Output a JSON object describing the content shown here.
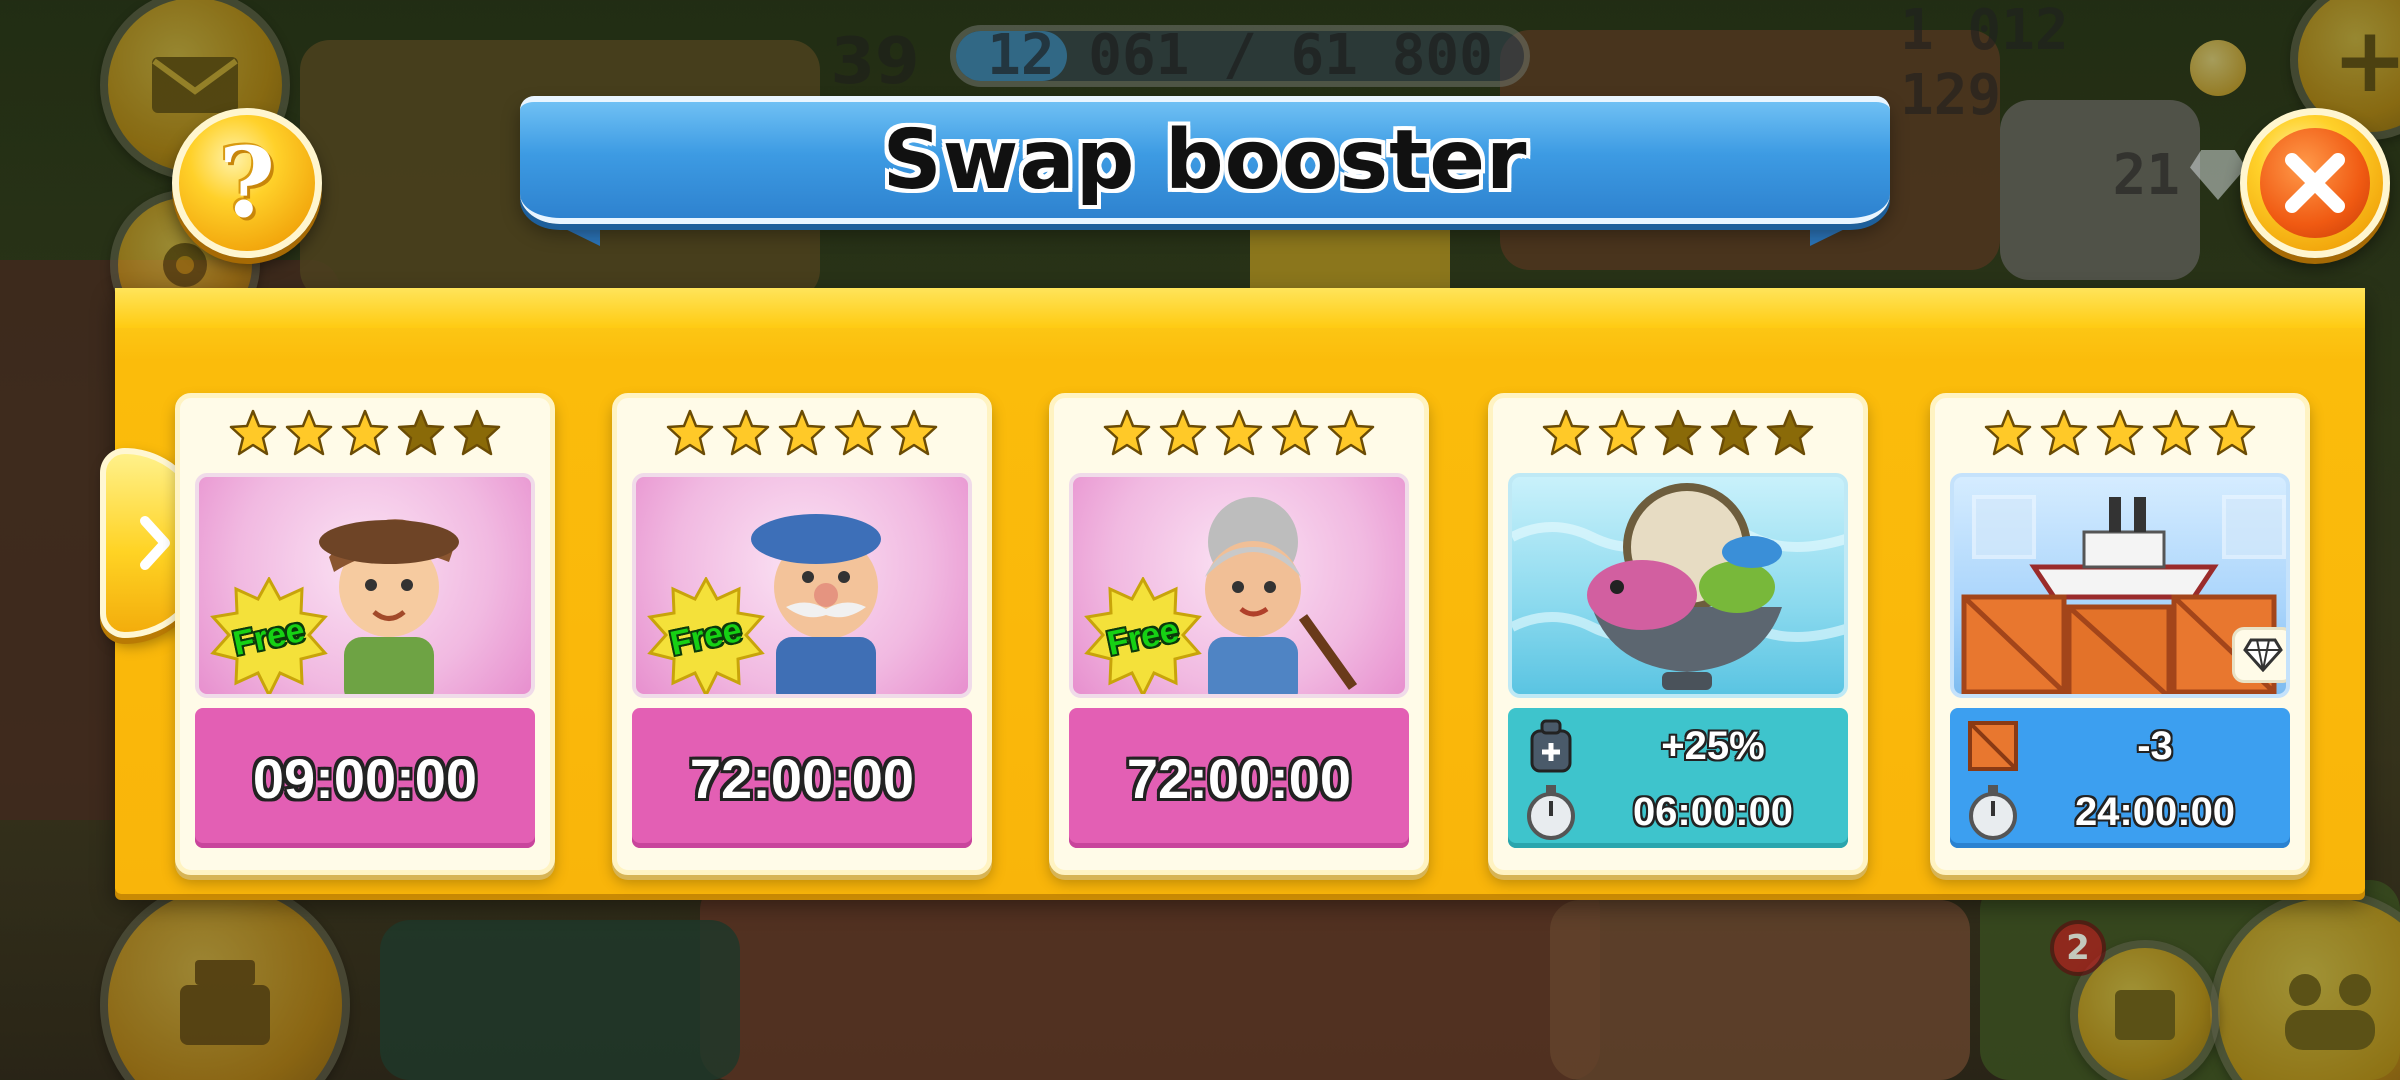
{
  "hud": {
    "level": "39",
    "xp_text": "12 061 / 61 800",
    "xp_progress": 0.195,
    "coins": "1 012 129",
    "gems": "21",
    "notification_count": "2"
  },
  "dialog": {
    "title": "Swap booster",
    "help_glyph": "?",
    "cards": [
      {
        "kind": "helper",
        "stars": 3,
        "free_label": "Free",
        "timer": "09:00:00",
        "icon": "boy-helper-icon"
      },
      {
        "kind": "helper",
        "stars": 5,
        "free_label": "Free",
        "timer": "72:00:00",
        "icon": "grandpa-helper-icon"
      },
      {
        "kind": "helper",
        "stars": 5,
        "free_label": "Free",
        "timer": "72:00:00",
        "icon": "grandma-helper-icon"
      },
      {
        "kind": "booster",
        "stars": 2,
        "bonus": "+25%",
        "timer": "06:00:00",
        "icon": "fish-bowl-icon"
      },
      {
        "kind": "booster",
        "stars": 5,
        "bonus": "-3",
        "timer": "24:00:00",
        "icon": "boat-crates-icon"
      }
    ]
  },
  "colors": {
    "panel": "#f9b50a",
    "ribbon": "#3d9be3",
    "timer_pink": "#e35fb4",
    "teal": "#3ec4cc",
    "blue": "#3c9ff0",
    "star_gold": "#ffc928",
    "star_dim": "#8a6a08"
  }
}
